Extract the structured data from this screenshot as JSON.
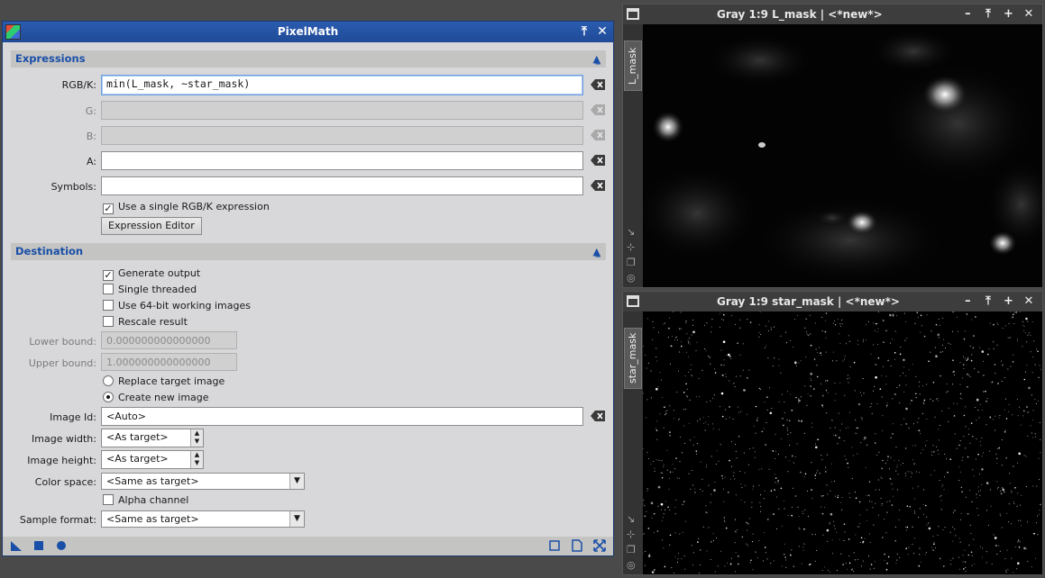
{
  "dialog": {
    "title": "PixelMath",
    "buttons": {
      "shade": "⤒",
      "close": "✕"
    }
  },
  "expressions": {
    "section_label": "Expressions",
    "rgbk": {
      "label": "RGB/K:",
      "value": "min(L_mask, ~star_mask)"
    },
    "g": {
      "label": "G:",
      "value": ""
    },
    "b": {
      "label": "B:",
      "value": ""
    },
    "a": {
      "label": "A:",
      "value": ""
    },
    "symbols": {
      "label": "Symbols:",
      "value": ""
    },
    "single_expression": {
      "label": "Use a single RGB/K expression",
      "checked": true
    },
    "editor_button": "Expression Editor"
  },
  "destination": {
    "section_label": "Destination",
    "generate_output": {
      "label": "Generate output",
      "checked": true
    },
    "single_threaded": {
      "label": "Single threaded",
      "checked": false
    },
    "use_64bit": {
      "label": "Use 64-bit working images",
      "checked": false
    },
    "rescale": {
      "label": "Rescale result",
      "checked": false
    },
    "lower_bound": {
      "label": "Lower bound:",
      "value": "0.000000000000000"
    },
    "upper_bound": {
      "label": "Upper bound:",
      "value": "1.000000000000000"
    },
    "replace_target": {
      "label": "Replace target image",
      "selected": false
    },
    "create_new": {
      "label": "Create new image",
      "selected": true
    },
    "image_id": {
      "label": "Image Id:",
      "value": "<Auto>"
    },
    "image_width": {
      "label": "Image width:",
      "value": "<As target>"
    },
    "image_height": {
      "label": "Image height:",
      "value": "<As target>"
    },
    "color_space": {
      "label": "Color space:",
      "value": "<Same as target>"
    },
    "alpha_channel": {
      "label": "Alpha channel",
      "checked": false
    },
    "sample_format": {
      "label": "Sample format:",
      "value": "<Same as target>"
    }
  },
  "windows": [
    {
      "title": "Gray 1:9 L_mask | <*new*>",
      "side_tab": "L_mask",
      "buttons": {
        "minimize": "–",
        "shade": "⤒",
        "maximize": "+",
        "close": "✕"
      }
    },
    {
      "title": "Gray 1:9 star_mask | <*new*>",
      "side_tab": "star_mask",
      "buttons": {
        "minimize": "–",
        "shade": "⤒",
        "maximize": "+",
        "close": "✕"
      }
    }
  ],
  "colors": {
    "accent_blue": "#1a4fa8",
    "title_bar": "#2b5cb0",
    "dialog_bg": "#d8d8db",
    "desktop_bg": "#4a4a4a"
  }
}
